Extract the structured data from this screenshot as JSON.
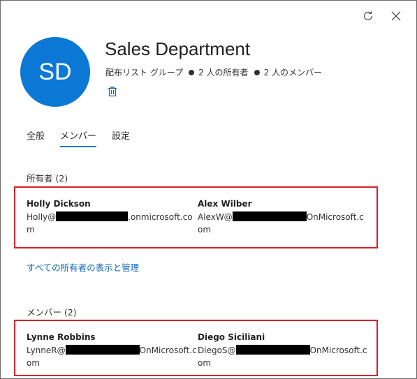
{
  "header": {
    "refresh_icon": "refresh-icon",
    "close_icon": "close-icon"
  },
  "group": {
    "initials": "SD",
    "name": "Sales Department",
    "type": "配布リスト グループ",
    "owners_count_text": "2 人の所有者",
    "members_count_text": "2 人のメンバー",
    "avatar_color": "#0a78d4"
  },
  "tabs": [
    {
      "label": "全般",
      "active": false
    },
    {
      "label": "メンバー",
      "active": true
    },
    {
      "label": "設定",
      "active": false
    }
  ],
  "owners": {
    "label": "所有者 (2)",
    "people": [
      {
        "name": "Holly Dickson",
        "email_prefix": "Holly@",
        "email_suffix": ".onmicrosoft.com"
      },
      {
        "name": "Alex Wilber",
        "email_prefix": "AlexW@",
        "email_suffix": "OnMicrosoft.com"
      }
    ],
    "link": "すべての所有者の表示と管理"
  },
  "members": {
    "label": "メンバー (2)",
    "people": [
      {
        "name": "Lynne Robbins",
        "email_prefix": "LynneR@",
        "email_suffix": "OnMicrosoft.com"
      },
      {
        "name": "Diego Siciliani",
        "email_prefix": "DiegoS@",
        "email_suffix": "OnMicrosoft.com"
      }
    ]
  },
  "colors": {
    "accent": "#0078d4",
    "highlight_border": "#d6202b",
    "link": "#0a66b8"
  }
}
